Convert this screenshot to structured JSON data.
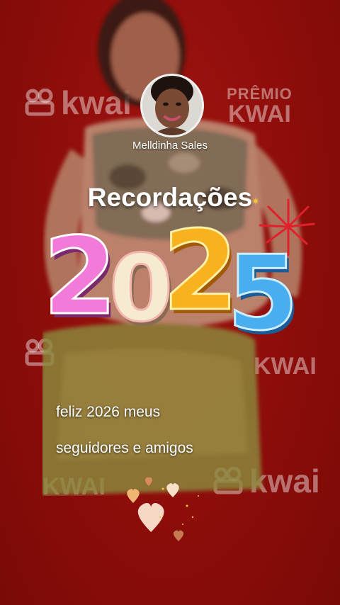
{
  "profile": {
    "username": "Melldinha Sales"
  },
  "card": {
    "title": "Recordações",
    "year": "2025",
    "caption_line1": "feliz 2026 meus",
    "caption_line2": "seguidores e amigos"
  },
  "watermarks": {
    "kwai_text": "kwai",
    "kwai_upper": "KWAI",
    "premio_line1": "PRÊMIO",
    "premio_line2": "KWAI"
  },
  "colors": {
    "background": "#8f0f0b",
    "digit_2_pink": "#f27ad8",
    "digit_0_cream": "#f6ead0",
    "digit_2_yellow": "#f7b21e",
    "digit_5_blue": "#49aef0",
    "firework": "#e0202a"
  },
  "icons": [
    "kwai-logo-icon",
    "firework-icon",
    "heart-icon",
    "sparkle-icon"
  ]
}
